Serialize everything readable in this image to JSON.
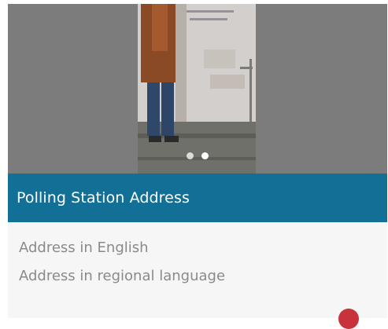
{
  "carousel": {
    "slide_count": 2,
    "active_index": 1,
    "colors": {
      "background": "#7c7c7c",
      "dot": "#ffffff"
    }
  },
  "header": {
    "title": "Polling Station Address",
    "background_color": "#127096"
  },
  "address": {
    "english_label": "Address in English",
    "regional_label": "Address in regional language"
  },
  "fab": {
    "color": "#c8323a"
  }
}
